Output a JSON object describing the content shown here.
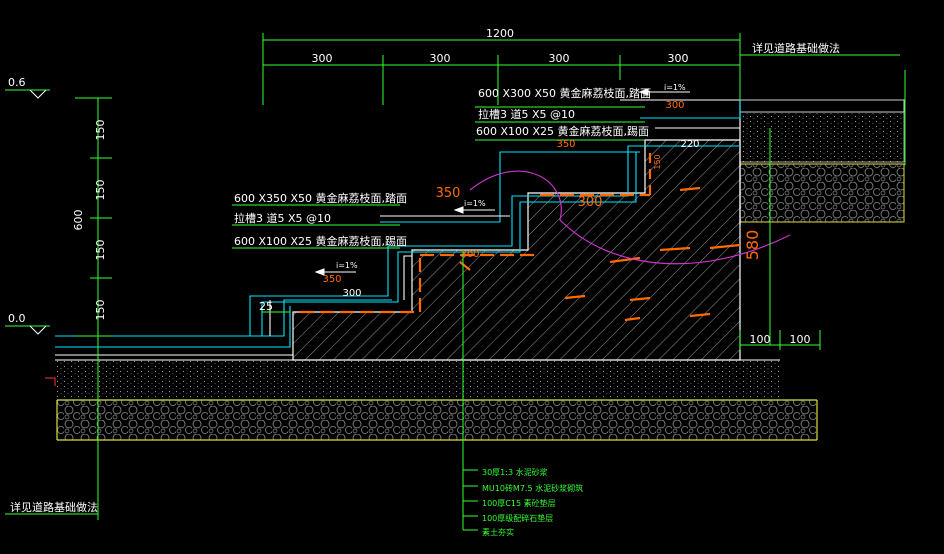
{
  "colors": {
    "background": "#000000",
    "outline": "#ffffff",
    "dimension": "#33ff33",
    "layers": "#00e5ff",
    "rebar": "#ff6a00",
    "arc": "#cc33cc",
    "gravel": "#d8d84a"
  },
  "dimensions": {
    "total_width": "1200",
    "segments": [
      "300",
      "300",
      "300",
      "300"
    ],
    "risers": [
      "150",
      "150",
      "150",
      "150"
    ],
    "total_height": "600",
    "base_right": [
      "100",
      "100"
    ],
    "small": "25",
    "tread_top": "300",
    "tread_mid_upper": "350",
    "tread_mid_lower": "300",
    "tread_mid_back": "220",
    "tread_low": "350",
    "tread_low_back": "300",
    "tread_low_back2": "300",
    "orange_350": "350",
    "orange_300": "300",
    "depth_580": "580",
    "riser_small": "150"
  },
  "levels": {
    "top": "0.6",
    "bottom": "0.0"
  },
  "annotations": {
    "top_right_ref": "详见道路基础做法",
    "bottom_left_ref": "详见道路基础做法",
    "upper_tread_stone": "600 X300 X50  黄金麻荔枝面,踏面",
    "upper_groove": "拉槽3 道5 X5 @10",
    "upper_riser_stone": "600 X100 X25  黄金麻荔枝面,踢面",
    "lower_tread_stone": "600 X350 X50  黄金麻荔枝面,踏面",
    "lower_groove": "拉槽3 道5 X5 @10",
    "lower_riser_stone": "600 X100 X25  黄金麻荔枝面,踢面",
    "slope_top": "i=1%",
    "slope_mid": "i=1%",
    "slope_low": "i=1%"
  },
  "layers": [
    "30厚1:3 水泥砂浆",
    "MU10砖M7.5 水泥砂浆砌筑",
    "100厚C15 素砼垫层",
    "100厚级配碎石垫层",
    "素土夯实"
  ]
}
